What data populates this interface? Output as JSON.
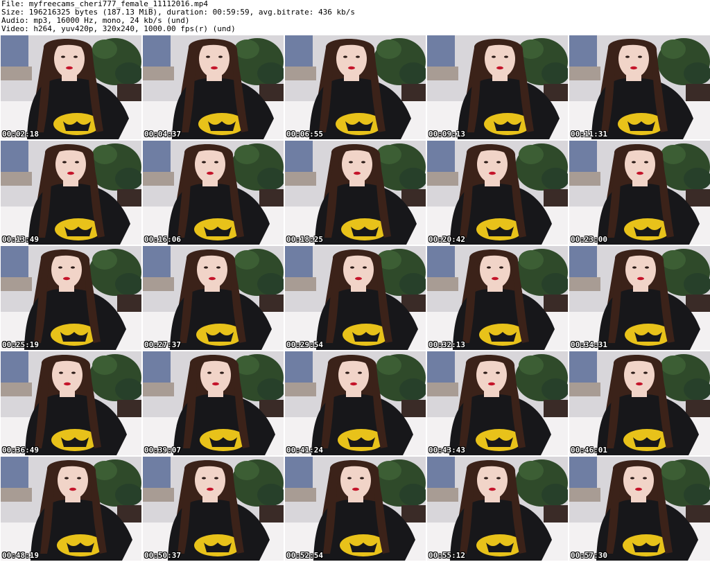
{
  "header": {
    "file_line": "File: myfreecams_cheri777_female_11112016.mp4",
    "size_line": "Size: 196216325 bytes (187.13 MiB), duration: 00:59:59, avg.bitrate: 436 kb/s",
    "audio_line": "Audio: mp3, 16000 Hz, mono, 24 kb/s (und)",
    "video_line": "Video: h264, yuv420p, 320x240, 1000.00 fps(r) (und)"
  },
  "thumbnails": [
    {
      "timestamp": "00:02:18"
    },
    {
      "timestamp": "00:04:37"
    },
    {
      "timestamp": "00:06:55"
    },
    {
      "timestamp": "00:09:13"
    },
    {
      "timestamp": "00:11:31"
    },
    {
      "timestamp": "00:13:49"
    },
    {
      "timestamp": "00:16:06"
    },
    {
      "timestamp": "00:18:25"
    },
    {
      "timestamp": "00:20:42"
    },
    {
      "timestamp": "00:23:00"
    },
    {
      "timestamp": "00:25:19"
    },
    {
      "timestamp": "00:27:37"
    },
    {
      "timestamp": "00:29:54"
    },
    {
      "timestamp": "00:32:13"
    },
    {
      "timestamp": "00:34:31"
    },
    {
      "timestamp": "00:36:49"
    },
    {
      "timestamp": "00:39:07"
    },
    {
      "timestamp": "00:41:24"
    },
    {
      "timestamp": "00:43:43"
    },
    {
      "timestamp": "00:46:01"
    },
    {
      "timestamp": "00:48:19"
    },
    {
      "timestamp": "00:50:37"
    },
    {
      "timestamp": "00:52:54"
    },
    {
      "timestamp": "00:55:12"
    },
    {
      "timestamp": "00:57:30"
    }
  ],
  "colors": {
    "hair": "#3b2219",
    "skin": "#f1d4c8",
    "shirt": "#17171a",
    "logo": "#e8c21a",
    "lips": "#c4142a",
    "wall": "#d8d6da",
    "plant": "#2f4a2a",
    "curtain": "#5d6f99",
    "bed": "#f3f1f2"
  }
}
